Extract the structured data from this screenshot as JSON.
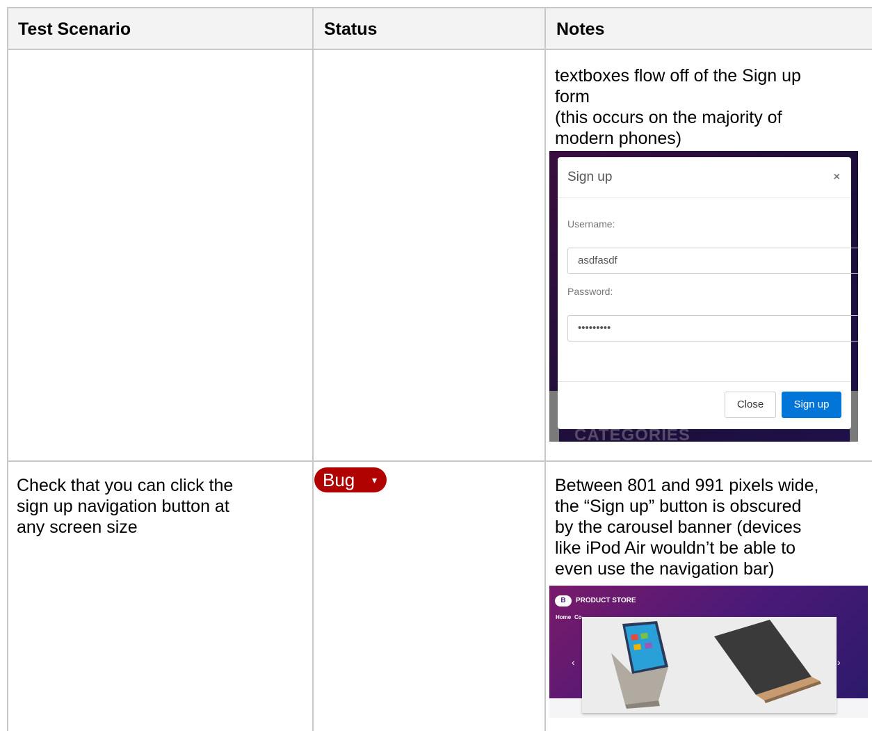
{
  "table": {
    "headers": [
      "Test Scenario",
      "Status",
      "Notes"
    ],
    "row1": {
      "notes": [
        "textboxes flow off of the Sign up",
        "form",
        "(this occurs on the majority of",
        "modern phones)"
      ],
      "screenshot": {
        "modal_title": "Sign up",
        "close_x": "×",
        "username_label": "Username:",
        "username_value": "asdfasdf",
        "password_label": "Password:",
        "password_value": "•••••••••",
        "close_button": "Close",
        "signup_button": "Sign up",
        "background_text": "CATEGORIES"
      }
    },
    "row2": {
      "scenario": [
        "Check that you can click the",
        "sign up navigation button at",
        "any screen size"
      ],
      "status": "Bug",
      "status_arrow": "▾",
      "notes": [
        "Between 801 and 991 pixels wide,",
        "the “Sign up” button is obscured",
        "by the carousel banner (devices",
        "like iPod Air wouldn’t be able to",
        "even use the navigation bar)"
      ],
      "screenshot": {
        "logo": "B",
        "store_name": "PRODUCT STORE",
        "nav_home": "Home",
        "nav_partial": "Co",
        "prev": "‹",
        "next": "›"
      }
    }
  },
  "colors": {
    "header_bg": "#f3f3f3",
    "grid": "#c8c8c8",
    "bug_chip": "#b10202",
    "signup_blue": "#0275d8"
  }
}
